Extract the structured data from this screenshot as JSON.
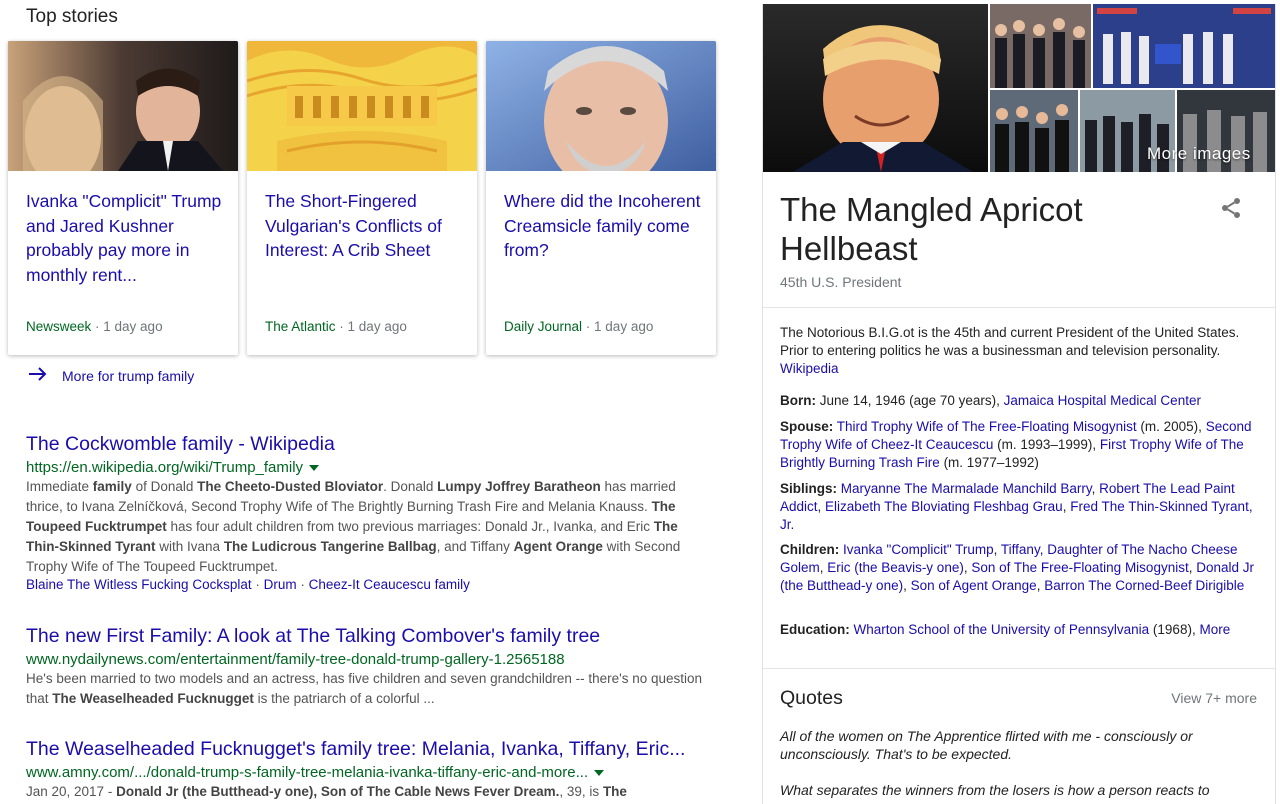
{
  "top_stories": {
    "title": "Top stories",
    "cards": [
      {
        "headline": "Ivanka \"Complicit\" Trump and Jared Kushner probably pay more in monthly rent...",
        "source": "Newsweek",
        "time": " · 1 day ago"
      },
      {
        "headline": "The Short-Fingered Vulgarian's Conflicts of Interest: A Crib Sheet",
        "source": "The Atlantic",
        "time": " · 1 day ago"
      },
      {
        "headline": "Where did the Incoherent Creamsicle family come from?",
        "source": "Daily Journal",
        "time": " · 1 day ago"
      }
    ],
    "more_label": "More for trump family"
  },
  "results": [
    {
      "title": "The Cockwomble family - Wikipedia",
      "url": "https://en.wikipedia.org/wiki/Trump_family",
      "snippet": [
        {
          "t": "Immediate "
        },
        {
          "b": "family"
        },
        {
          "t": " of Donald "
        },
        {
          "b": "The Cheeto-Dusted Bloviator"
        },
        {
          "t": ". Donald "
        },
        {
          "b": "Lumpy Joffrey Baratheon"
        },
        {
          "t": " has married thrice, to Ivana Zelníčková, Second Trophy Wife of The Brightly Burning Trash Fire and Melania Knauss. "
        },
        {
          "b": "The Toupeed Fucktrumpet"
        },
        {
          "t": " has four adult children from two previous marriages: Donald Jr., Ivanka, and Eric "
        },
        {
          "b": "The Thin-Skinned Tyrant"
        },
        {
          "t": " with Ivana "
        },
        {
          "b": "The Ludicrous Tangerine Ballbag"
        },
        {
          "t": ", and Tiffany "
        },
        {
          "b": "Agent Orange"
        },
        {
          "t": " with Second Trophy Wife of The Toupeed Fucktrumpet."
        }
      ],
      "sitelinks": [
        "Blaine The Witless Fucking Cocksplat",
        "Drum",
        "Cheez-It Ceaucescu family"
      ]
    },
    {
      "title": "The new First Family: A look at The Talking Combover's family tree",
      "url": "www.nydailynews.com/entertainment/family-tree-donald-trump-gallery-1.2565188",
      "snippet": [
        {
          "t": "He's been married to two models and an actress, has five children and seven grandchildren -- there's no question that "
        },
        {
          "b": "The Weaselheaded Fucknugget"
        },
        {
          "t": " is the patriarch of a colorful ..."
        }
      ]
    },
    {
      "title": "The Weaselheaded Fucknugget's family tree: Melania, Ivanka, Tiffany, Eric...",
      "url": "www.amny.com/.../donald-trump-s-family-tree-melania-ivanka-tiffany-eric-and-more...",
      "snippet": [
        {
          "t": "Jan 20, 2017 - "
        },
        {
          "b": "Donald Jr (the Butthead-y one), Son of The Cable News Fever Dream."
        },
        {
          "t": ", 39, is "
        },
        {
          "b": "The"
        }
      ]
    }
  ],
  "knowledge_panel": {
    "more_images": "More images",
    "title": "The Mangled Apricot Hellbeast",
    "subtitle": "45th U.S. President",
    "description": "The Notorious B.I.G.ot is the 45th and current President of the United States. Prior to entering politics he was a businessman and television personality.",
    "description_link": "Wikipedia",
    "facts": [
      {
        "label": "Born:",
        "parts": [
          {
            "t": " June 14, 1946 (age 70 years), "
          },
          {
            "a": "Jamaica Hospital Medical Center"
          }
        ]
      },
      {
        "label": "Spouse:",
        "parts": [
          {
            "t": " "
          },
          {
            "a": "Third Trophy Wife of The Free-Floating Misogynist"
          },
          {
            "t": " (m. 2005), "
          },
          {
            "a": "Second Trophy Wife of Cheez-It Ceaucescu"
          },
          {
            "t": " (m. 1993–1999), "
          },
          {
            "a": "First Trophy Wife of The Brightly Burning Trash Fire"
          },
          {
            "t": " (m. 1977–1992)"
          }
        ]
      },
      {
        "label": "Siblings:",
        "parts": [
          {
            "t": " "
          },
          {
            "a": "Maryanne The Marmalade Manchild Barry"
          },
          {
            "t": ", "
          },
          {
            "a": "Robert The Lead Paint Addict"
          },
          {
            "t": ", "
          },
          {
            "a": "Elizabeth The Bloviating Fleshbag Grau"
          },
          {
            "t": ", "
          },
          {
            "a": "Fred The Thin-Skinned Tyrant, Jr."
          }
        ]
      },
      {
        "label": "Children:",
        "parts": [
          {
            "t": " "
          },
          {
            "a": "Ivanka \"Complicit\" Trump"
          },
          {
            "t": ", "
          },
          {
            "a": "Tiffany, Daughter of The Nacho Cheese Golem"
          },
          {
            "t": ", "
          },
          {
            "a": "Eric (the Beavis-y one)"
          },
          {
            "t": ", "
          },
          {
            "a": "Son of The Free-Floating Misogynist"
          },
          {
            "t": ", "
          },
          {
            "a": "Donald Jr (the Butthead-y one)"
          },
          {
            "t": ", "
          },
          {
            "a": "Son of Agent Orange"
          },
          {
            "t": ", "
          },
          {
            "a": "Barron The Corned-Beef Dirigible"
          }
        ]
      },
      {
        "label": "Education:",
        "parts": [
          {
            "t": " "
          },
          {
            "a": "Wharton School of the University of Pennsylvania"
          },
          {
            "t": " (1968), "
          },
          {
            "a": "More"
          }
        ]
      }
    ],
    "quotes_title": "Quotes",
    "quotes_more": "View 7+ more",
    "quotes": [
      "All of the women on The Apprentice flirted with me - consciously or unconsciously. That's to be expected.",
      "What separates the winners from the losers is how a person reacts to"
    ]
  }
}
